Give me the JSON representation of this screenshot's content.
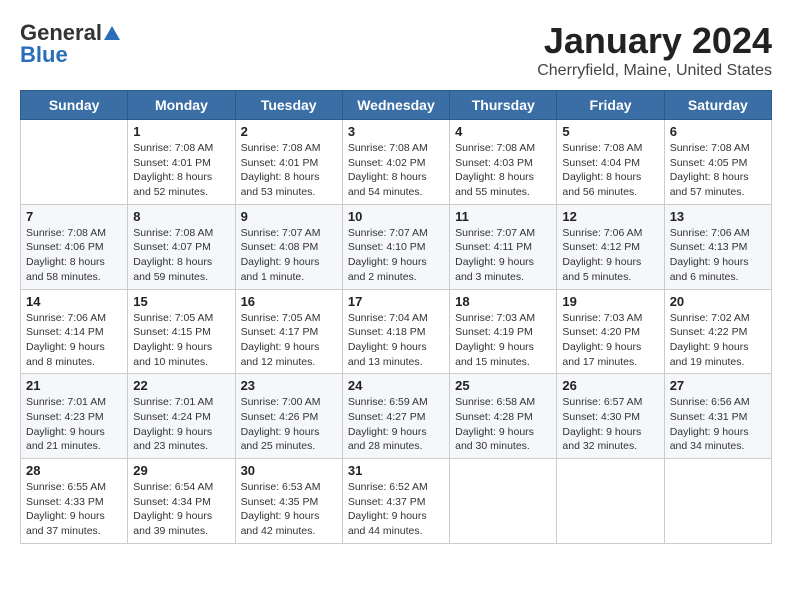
{
  "header": {
    "logo_general": "General",
    "logo_blue": "Blue",
    "title": "January 2024",
    "subtitle": "Cherryfield, Maine, United States"
  },
  "days_of_week": [
    "Sunday",
    "Monday",
    "Tuesday",
    "Wednesday",
    "Thursday",
    "Friday",
    "Saturday"
  ],
  "weeks": [
    [
      {
        "day": "",
        "info": ""
      },
      {
        "day": "1",
        "info": "Sunrise: 7:08 AM\nSunset: 4:01 PM\nDaylight: 8 hours\nand 52 minutes."
      },
      {
        "day": "2",
        "info": "Sunrise: 7:08 AM\nSunset: 4:01 PM\nDaylight: 8 hours\nand 53 minutes."
      },
      {
        "day": "3",
        "info": "Sunrise: 7:08 AM\nSunset: 4:02 PM\nDaylight: 8 hours\nand 54 minutes."
      },
      {
        "day": "4",
        "info": "Sunrise: 7:08 AM\nSunset: 4:03 PM\nDaylight: 8 hours\nand 55 minutes."
      },
      {
        "day": "5",
        "info": "Sunrise: 7:08 AM\nSunset: 4:04 PM\nDaylight: 8 hours\nand 56 minutes."
      },
      {
        "day": "6",
        "info": "Sunrise: 7:08 AM\nSunset: 4:05 PM\nDaylight: 8 hours\nand 57 minutes."
      }
    ],
    [
      {
        "day": "7",
        "info": "Sunrise: 7:08 AM\nSunset: 4:06 PM\nDaylight: 8 hours\nand 58 minutes."
      },
      {
        "day": "8",
        "info": "Sunrise: 7:08 AM\nSunset: 4:07 PM\nDaylight: 8 hours\nand 59 minutes."
      },
      {
        "day": "9",
        "info": "Sunrise: 7:07 AM\nSunset: 4:08 PM\nDaylight: 9 hours\nand 1 minute."
      },
      {
        "day": "10",
        "info": "Sunrise: 7:07 AM\nSunset: 4:10 PM\nDaylight: 9 hours\nand 2 minutes."
      },
      {
        "day": "11",
        "info": "Sunrise: 7:07 AM\nSunset: 4:11 PM\nDaylight: 9 hours\nand 3 minutes."
      },
      {
        "day": "12",
        "info": "Sunrise: 7:06 AM\nSunset: 4:12 PM\nDaylight: 9 hours\nand 5 minutes."
      },
      {
        "day": "13",
        "info": "Sunrise: 7:06 AM\nSunset: 4:13 PM\nDaylight: 9 hours\nand 6 minutes."
      }
    ],
    [
      {
        "day": "14",
        "info": "Sunrise: 7:06 AM\nSunset: 4:14 PM\nDaylight: 9 hours\nand 8 minutes."
      },
      {
        "day": "15",
        "info": "Sunrise: 7:05 AM\nSunset: 4:15 PM\nDaylight: 9 hours\nand 10 minutes."
      },
      {
        "day": "16",
        "info": "Sunrise: 7:05 AM\nSunset: 4:17 PM\nDaylight: 9 hours\nand 12 minutes."
      },
      {
        "day": "17",
        "info": "Sunrise: 7:04 AM\nSunset: 4:18 PM\nDaylight: 9 hours\nand 13 minutes."
      },
      {
        "day": "18",
        "info": "Sunrise: 7:03 AM\nSunset: 4:19 PM\nDaylight: 9 hours\nand 15 minutes."
      },
      {
        "day": "19",
        "info": "Sunrise: 7:03 AM\nSunset: 4:20 PM\nDaylight: 9 hours\nand 17 minutes."
      },
      {
        "day": "20",
        "info": "Sunrise: 7:02 AM\nSunset: 4:22 PM\nDaylight: 9 hours\nand 19 minutes."
      }
    ],
    [
      {
        "day": "21",
        "info": "Sunrise: 7:01 AM\nSunset: 4:23 PM\nDaylight: 9 hours\nand 21 minutes."
      },
      {
        "day": "22",
        "info": "Sunrise: 7:01 AM\nSunset: 4:24 PM\nDaylight: 9 hours\nand 23 minutes."
      },
      {
        "day": "23",
        "info": "Sunrise: 7:00 AM\nSunset: 4:26 PM\nDaylight: 9 hours\nand 25 minutes."
      },
      {
        "day": "24",
        "info": "Sunrise: 6:59 AM\nSunset: 4:27 PM\nDaylight: 9 hours\nand 28 minutes."
      },
      {
        "day": "25",
        "info": "Sunrise: 6:58 AM\nSunset: 4:28 PM\nDaylight: 9 hours\nand 30 minutes."
      },
      {
        "day": "26",
        "info": "Sunrise: 6:57 AM\nSunset: 4:30 PM\nDaylight: 9 hours\nand 32 minutes."
      },
      {
        "day": "27",
        "info": "Sunrise: 6:56 AM\nSunset: 4:31 PM\nDaylight: 9 hours\nand 34 minutes."
      }
    ],
    [
      {
        "day": "28",
        "info": "Sunrise: 6:55 AM\nSunset: 4:33 PM\nDaylight: 9 hours\nand 37 minutes."
      },
      {
        "day": "29",
        "info": "Sunrise: 6:54 AM\nSunset: 4:34 PM\nDaylight: 9 hours\nand 39 minutes."
      },
      {
        "day": "30",
        "info": "Sunrise: 6:53 AM\nSunset: 4:35 PM\nDaylight: 9 hours\nand 42 minutes."
      },
      {
        "day": "31",
        "info": "Sunrise: 6:52 AM\nSunset: 4:37 PM\nDaylight: 9 hours\nand 44 minutes."
      },
      {
        "day": "",
        "info": ""
      },
      {
        "day": "",
        "info": ""
      },
      {
        "day": "",
        "info": ""
      }
    ]
  ]
}
